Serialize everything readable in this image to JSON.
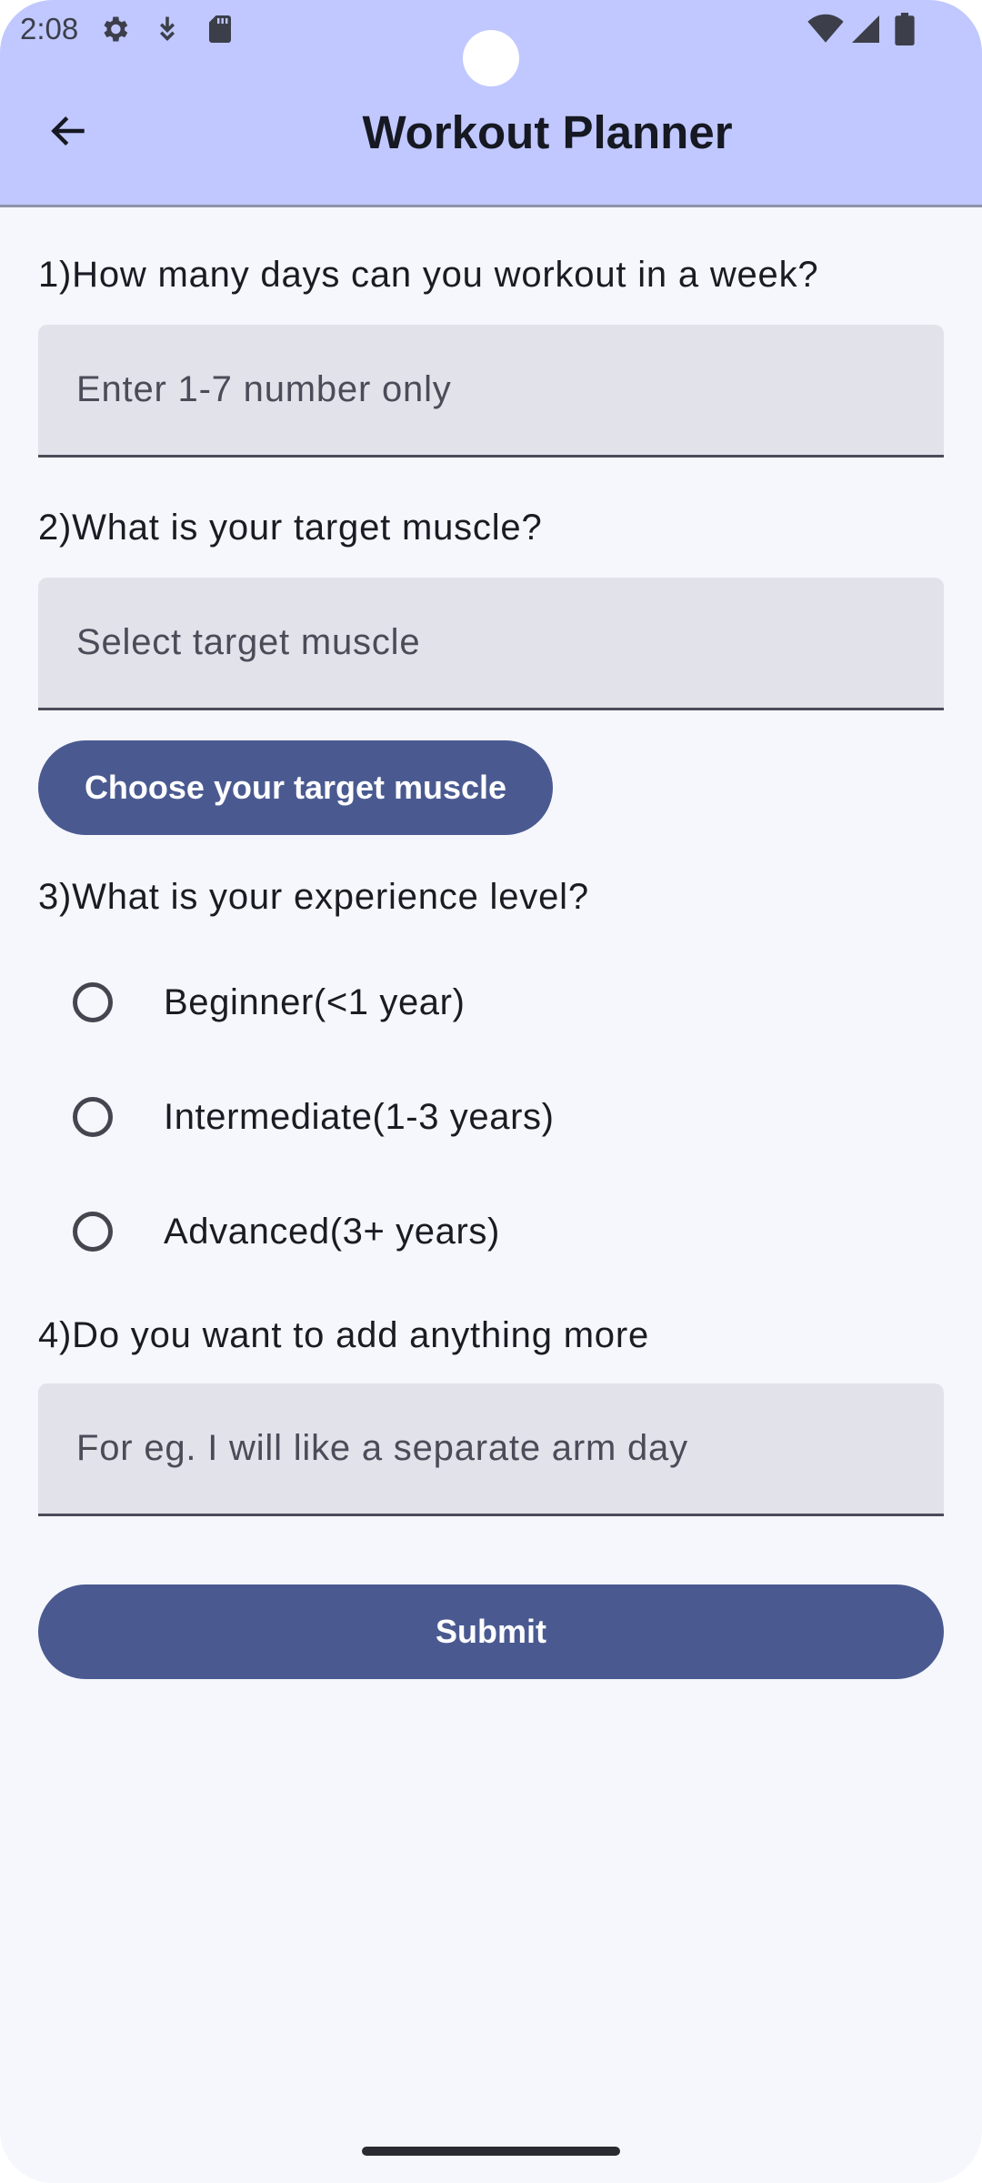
{
  "status_bar": {
    "time": "2:08",
    "icons_left": [
      "settings-icon",
      "download-icon",
      "sd-card-icon"
    ],
    "icons_right": [
      "wifi-icon",
      "signal-icon",
      "battery-icon"
    ]
  },
  "app_bar": {
    "title": "Workout Planner",
    "back_icon": "arrow-left-icon"
  },
  "form": {
    "q1": {
      "label": "1)How many days can you workout in a week?",
      "placeholder": "Enter 1-7 number only",
      "value": ""
    },
    "q2": {
      "label": "2)What is your target muscle?",
      "placeholder": "Select target muscle",
      "value": "",
      "button_label": "Choose your target muscle"
    },
    "q3": {
      "label": "3)What is your experience level?",
      "options": [
        {
          "label": "Beginner(<1 year)",
          "selected": false
        },
        {
          "label": "Intermediate(1-3 years)",
          "selected": false
        },
        {
          "label": "Advanced(3+ years)",
          "selected": false
        }
      ]
    },
    "q4": {
      "label": "4)Do you want to add anything more",
      "placeholder": "For eg. I will like a separate arm day",
      "value": ""
    },
    "submit_label": "Submit"
  },
  "colors": {
    "app_bar_bg": "#c0c8ff",
    "page_bg": "#f6f7fc",
    "field_bg": "#e2e2ea",
    "button_bg": "#4a5a91"
  }
}
